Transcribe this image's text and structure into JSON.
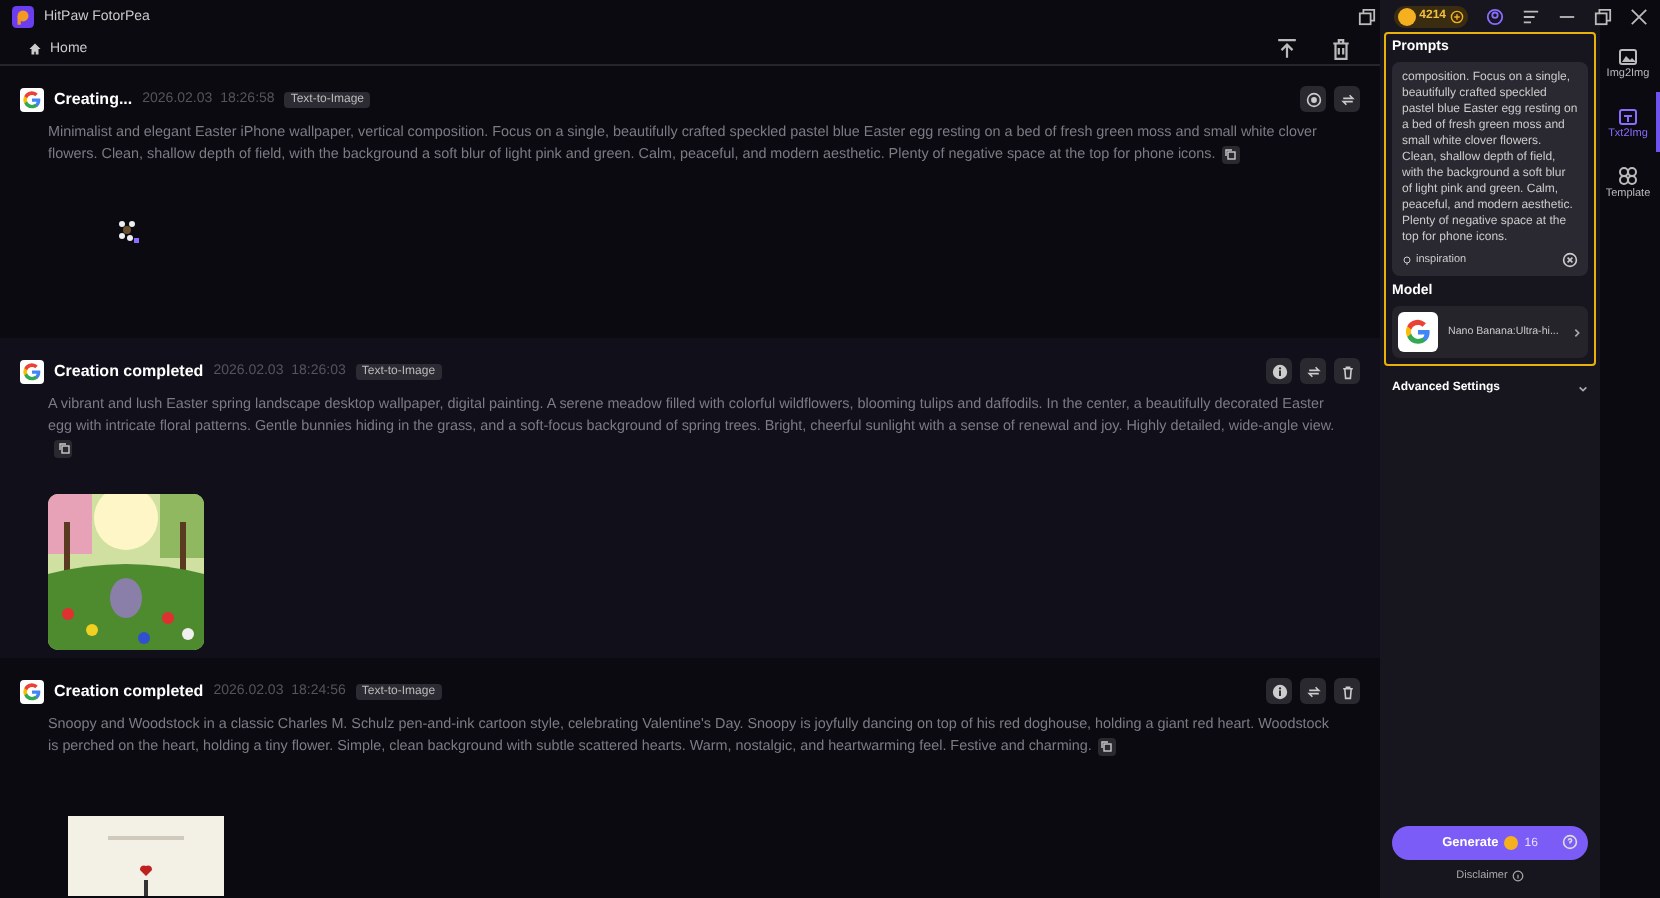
{
  "app": {
    "title": "HitPaw FotorPea",
    "coins": "4214"
  },
  "nav": {
    "home": "Home"
  },
  "cards": [
    {
      "kind": "creating",
      "status": "Creating...",
      "date": "2026.02.03",
      "time": "18:26:58",
      "tag": "Text-to-Image",
      "prompt": "Minimalist and elegant Easter iPhone wallpaper, vertical composition. Focus on a single, beautifully crafted speckled pastel blue Easter egg resting on a bed of fresh green moss and small white clover flowers. Clean, shallow depth of field, with the background a soft blur of light pink and green. Calm, peaceful, and modern aesthetic. Plenty of negative space at the top for phone icons."
    },
    {
      "kind": "completed",
      "status": "Creation completed",
      "date": "2026.02.03",
      "time": "18:26:03",
      "tag": "Text-to-Image",
      "prompt": "A vibrant and lush Easter spring landscape desktop wallpaper, digital painting. A serene meadow filled with colorful wildflowers, blooming tulips and daffodils. In the center, a beautifully decorated Easter egg with intricate floral patterns. Gentle bunnies hiding in the grass, and a soft-focus background of spring trees. Bright, cheerful sunlight with a sense of renewal and joy. Highly detailed, wide-angle view."
    },
    {
      "kind": "completed",
      "status": "Creation completed",
      "date": "2026.02.03",
      "time": "18:24:56",
      "tag": "Text-to-Image",
      "prompt": "Snoopy and Woodstock in a classic Charles M. Schulz pen-and-ink cartoon style, celebrating Valentine's Day. Snoopy is joyfully dancing on top of his red doghouse, holding a giant red heart. Woodstock is perched on the heart, holding a tiny flower. Simple, clean background with subtle scattered hearts. Warm, nostalgic, and heartwarming feel. Festive and charming."
    }
  ],
  "panel": {
    "prompts_title": "Prompts",
    "prompt_text": "composition. Focus on a single, beautifully crafted speckled pastel blue Easter egg resting on a bed of fresh green moss and small white clover flowers. Clean, shallow depth of field, with the background a soft blur of light pink and green. Calm, peaceful, and modern aesthetic. Plenty of negative space at the top for phone icons.",
    "inspiration": "inspiration",
    "model_title": "Model",
    "model_name": "Nano Banana:Ultra-hi...",
    "advanced": "Advanced Settings",
    "generate": "Generate",
    "cost": "16",
    "disclaimer": "Disclaimer"
  },
  "rail": [
    {
      "label": "Img2Img",
      "selected": false
    },
    {
      "label": "Txt2Img",
      "selected": true
    },
    {
      "label": "Template",
      "selected": false
    }
  ]
}
